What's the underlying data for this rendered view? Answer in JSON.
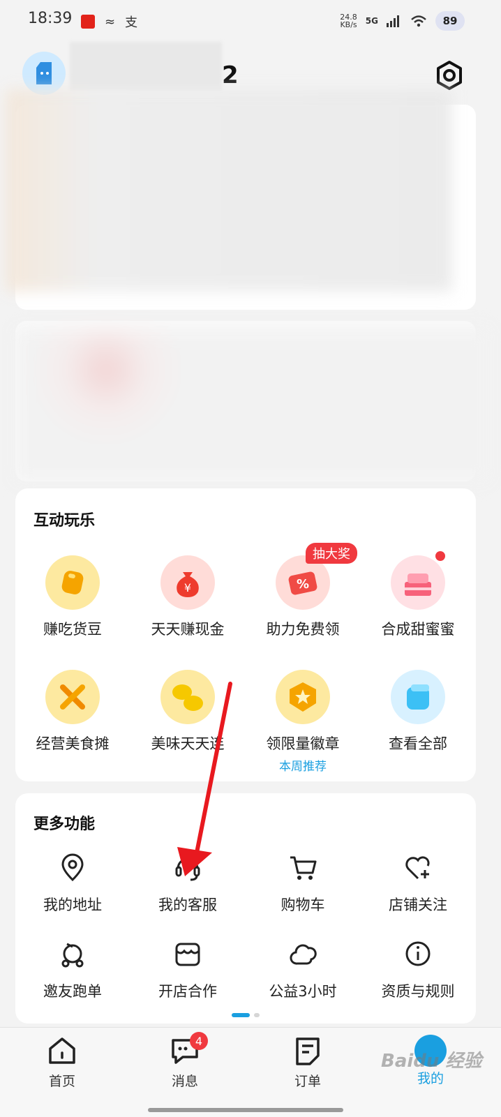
{
  "status_bar": {
    "time": "18:39",
    "icons": [
      "app-red-icon",
      "weibo-icon",
      "alipay-icon"
    ],
    "speed": "24.8",
    "speed_unit": "KB/s",
    "network": "5G",
    "battery": "89"
  },
  "header": {
    "username_suffix": "2",
    "settings_icon": "settings-icon"
  },
  "interactive_section": {
    "title": "互动玩乐",
    "items": [
      {
        "label": "赚吃货豆",
        "icon": "bean-icon",
        "color": "#fde9a0"
      },
      {
        "label": "天天赚现金",
        "icon": "money-bag-icon",
        "color": "#ffdcd8"
      },
      {
        "label": "助力免费领",
        "icon": "coupon-icon",
        "color": "#ffdcd8",
        "badge": "抽大奖"
      },
      {
        "label": "合成甜蜜蜜",
        "icon": "cake-icon",
        "color": "#ffe0e4"
      },
      {
        "label": "经营美食摊",
        "icon": "cooking-tools-icon",
        "color": "#fde9a0"
      },
      {
        "label": "美味天天连",
        "icon": "lemon-icon",
        "color": "#fde9a0"
      },
      {
        "label": "领限量徽章",
        "icon": "medal-icon",
        "color": "#fde9a0",
        "sub_label": "本周推荐"
      },
      {
        "label": "查看全部",
        "icon": "cube-icon",
        "color": "#d8f1ff"
      }
    ]
  },
  "more_section": {
    "title": "更多功能",
    "items": [
      {
        "label": "我的地址",
        "icon": "location-pin-icon"
      },
      {
        "label": "我的客服",
        "icon": "headset-icon"
      },
      {
        "label": "购物车",
        "icon": "cart-icon"
      },
      {
        "label": "店铺关注",
        "icon": "heart-plus-icon"
      },
      {
        "label": "邀友跑单",
        "icon": "scooter-icon"
      },
      {
        "label": "开店合作",
        "icon": "store-icon"
      },
      {
        "label": "公益3小时",
        "icon": "cloud-icon"
      },
      {
        "label": "资质与规则",
        "icon": "info-icon"
      }
    ]
  },
  "bottom_nav": {
    "items": [
      {
        "label": "首页",
        "icon": "home-icon"
      },
      {
        "label": "消息",
        "icon": "chat-icon",
        "badge": "4"
      },
      {
        "label": "订单",
        "icon": "order-icon"
      },
      {
        "label": "我的",
        "icon": "profile-icon",
        "active": true
      }
    ]
  },
  "colors": {
    "accent": "#1a9fe0",
    "badge_red": "#f0393f",
    "annotation_arrow": "#e8191f"
  }
}
